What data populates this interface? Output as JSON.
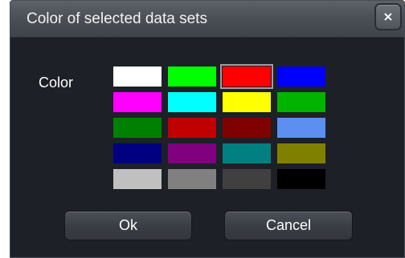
{
  "dialog": {
    "title": "Color of selected data sets",
    "close_icon": "×"
  },
  "color_label": "Color",
  "swatches": [
    {
      "name": "white",
      "color": "#ffffff",
      "selected": false
    },
    {
      "name": "green",
      "color": "#00ff00",
      "selected": false
    },
    {
      "name": "red",
      "color": "#ff0000",
      "selected": true
    },
    {
      "name": "blue",
      "color": "#0000ff",
      "selected": false
    },
    {
      "name": "magenta",
      "color": "#ff00ff",
      "selected": false
    },
    {
      "name": "cyan",
      "color": "#00ffff",
      "selected": false
    },
    {
      "name": "yellow",
      "color": "#ffff00",
      "selected": false
    },
    {
      "name": "medium-green",
      "color": "#00b400",
      "selected": false
    },
    {
      "name": "dark-green",
      "color": "#008000",
      "selected": false
    },
    {
      "name": "dark-red",
      "color": "#c00000",
      "selected": false
    },
    {
      "name": "maroon",
      "color": "#800000",
      "selected": false
    },
    {
      "name": "cornflower-blue",
      "color": "#5c8ff0",
      "selected": false
    },
    {
      "name": "navy",
      "color": "#000080",
      "selected": false
    },
    {
      "name": "purple",
      "color": "#800080",
      "selected": false
    },
    {
      "name": "teal",
      "color": "#008080",
      "selected": false
    },
    {
      "name": "olive",
      "color": "#808000",
      "selected": false
    },
    {
      "name": "light-gray",
      "color": "#c0c0c0",
      "selected": false
    },
    {
      "name": "gray",
      "color": "#808080",
      "selected": false
    },
    {
      "name": "dark-gray",
      "color": "#404040",
      "selected": false
    },
    {
      "name": "black",
      "color": "#000000",
      "selected": false
    }
  ],
  "buttons": {
    "ok_label": "Ok",
    "cancel_label": "Cancel"
  }
}
